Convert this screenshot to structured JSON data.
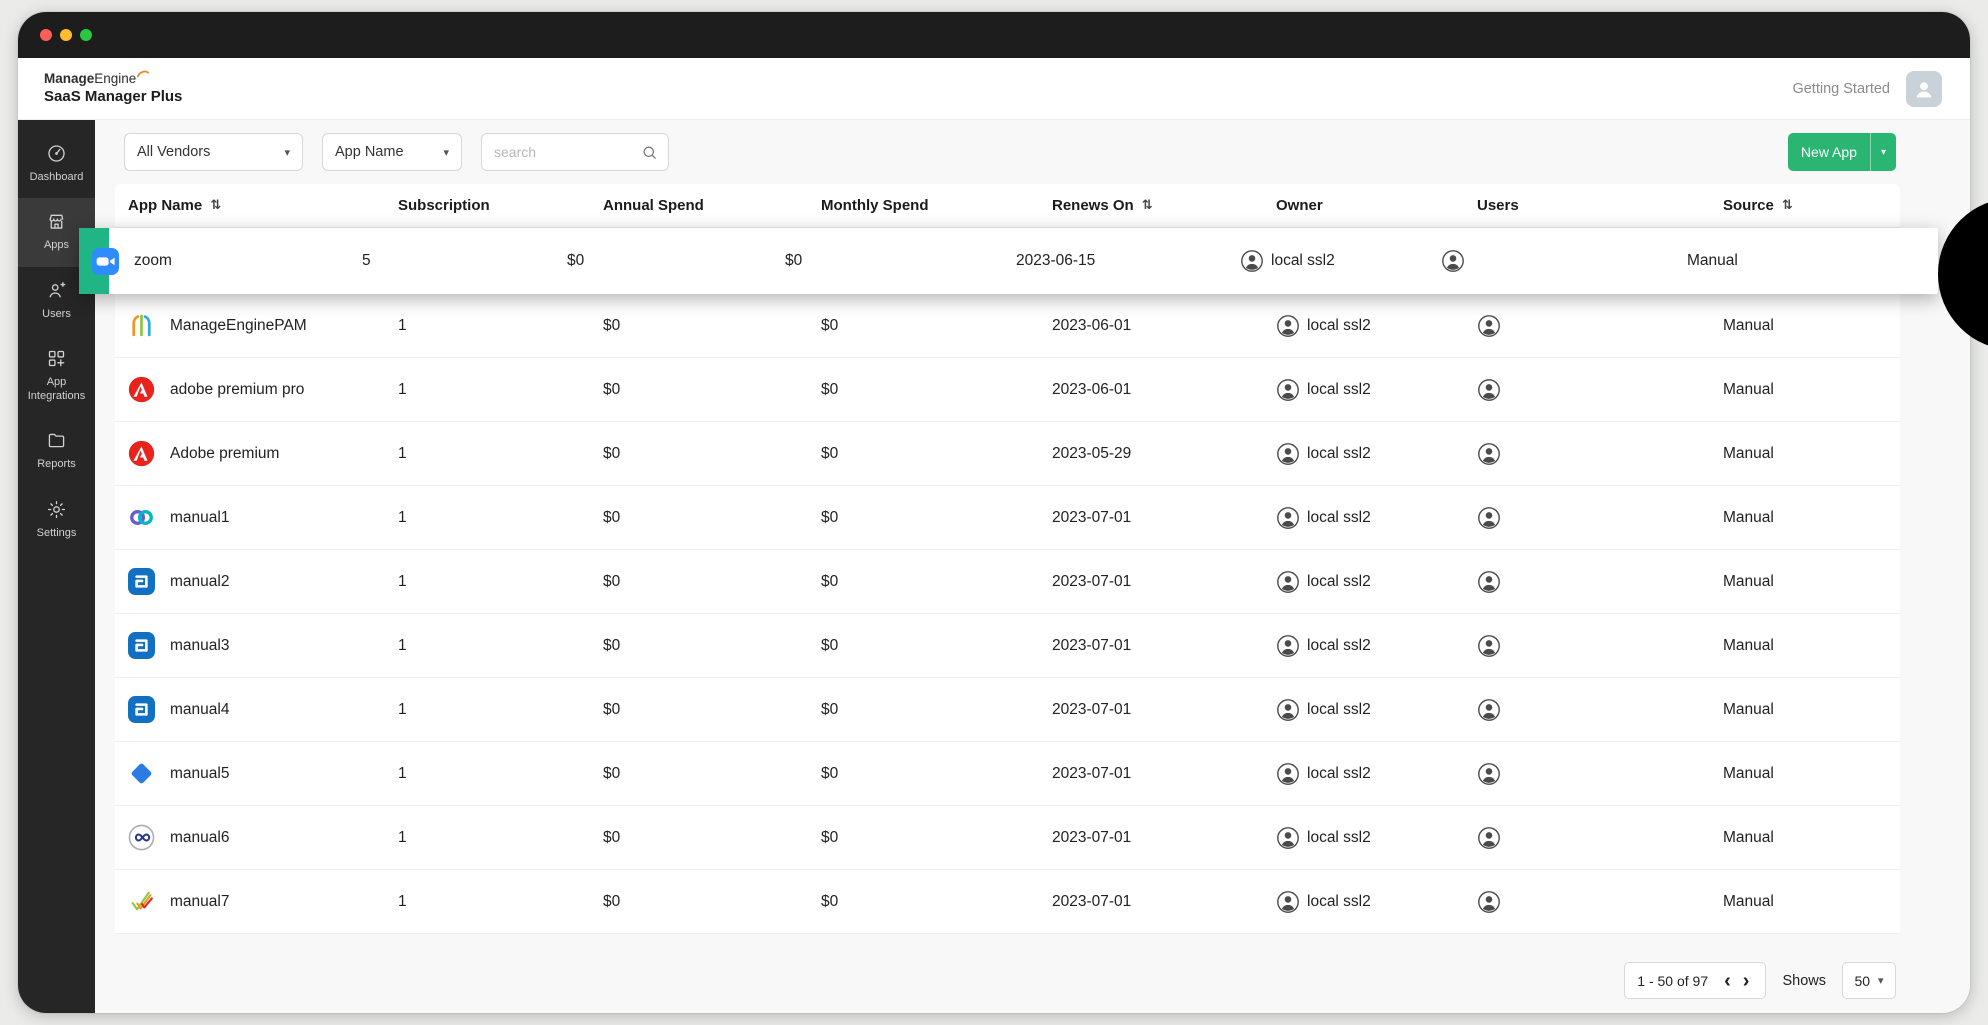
{
  "window": {
    "traffic_lights": [
      "#ff5f57",
      "#febc2e",
      "#28c840"
    ]
  },
  "header": {
    "brand_bold": "Manage",
    "brand_rest": "Engine",
    "brand_product": "SaaS Manager Plus",
    "getting_started": "Getting Started"
  },
  "sidebar": {
    "items": [
      {
        "label": "Dashboard",
        "icon": "dashboard-icon",
        "active": false
      },
      {
        "label": "Apps",
        "icon": "apps-icon",
        "active": true
      },
      {
        "label": "Users",
        "icon": "users-icon",
        "active": false
      },
      {
        "label": "App Integrations",
        "icon": "integrations-icon",
        "active": false
      },
      {
        "label": "Reports",
        "icon": "reports-icon",
        "active": false
      },
      {
        "label": "Settings",
        "icon": "settings-icon",
        "active": false
      }
    ]
  },
  "filters": {
    "vendor_select": "All Vendors",
    "field_select": "App Name",
    "search_placeholder": "search",
    "new_app_label": "New App"
  },
  "table": {
    "columns": [
      {
        "label": "App Name",
        "sortable": true
      },
      {
        "label": "Subscription",
        "sortable": false
      },
      {
        "label": "Annual Spend",
        "sortable": false
      },
      {
        "label": "Monthly Spend",
        "sortable": false
      },
      {
        "label": "Renews On",
        "sortable": true
      },
      {
        "label": "Owner",
        "sortable": false
      },
      {
        "label": "Users",
        "sortable": false
      },
      {
        "label": "Source",
        "sortable": true
      }
    ],
    "rows": [
      {
        "app": "zoom",
        "icon": "zoom-icon",
        "subscription": "5",
        "annual": "$0",
        "monthly": "$0",
        "renews": "2023-06-15",
        "owner": "local ssl2",
        "source": "Manual",
        "highlight": true
      },
      {
        "app": "ManageEnginePAM",
        "icon": "mepam-icon",
        "subscription": "1",
        "annual": "$0",
        "monthly": "$0",
        "renews": "2023-06-01",
        "owner": "local ssl2",
        "source": "Manual",
        "highlight": false
      },
      {
        "app": "adobe premium pro",
        "icon": "adobe-icon",
        "subscription": "1",
        "annual": "$0",
        "monthly": "$0",
        "renews": "2023-06-01",
        "owner": "local ssl2",
        "source": "Manual",
        "highlight": false
      },
      {
        "app": "Adobe premium",
        "icon": "adobe-icon",
        "subscription": "1",
        "annual": "$0",
        "monthly": "$0",
        "renews": "2023-05-29",
        "owner": "local ssl2",
        "source": "Manual",
        "highlight": false
      },
      {
        "app": "manual1",
        "icon": "rings-icon",
        "subscription": "1",
        "annual": "$0",
        "monthly": "$0",
        "renews": "2023-07-01",
        "owner": "local ssl2",
        "source": "Manual",
        "highlight": false
      },
      {
        "app": "manual2",
        "icon": "sd-icon",
        "subscription": "1",
        "annual": "$0",
        "monthly": "$0",
        "renews": "2023-07-01",
        "owner": "local ssl2",
        "source": "Manual",
        "highlight": false
      },
      {
        "app": "manual3",
        "icon": "sd-icon",
        "subscription": "1",
        "annual": "$0",
        "monthly": "$0",
        "renews": "2023-07-01",
        "owner": "local ssl2",
        "source": "Manual",
        "highlight": false
      },
      {
        "app": "manual4",
        "icon": "sd-icon",
        "subscription": "1",
        "annual": "$0",
        "monthly": "$0",
        "renews": "2023-07-01",
        "owner": "local ssl2",
        "source": "Manual",
        "highlight": false
      },
      {
        "app": "manual5",
        "icon": "diamond-icon",
        "subscription": "1",
        "annual": "$0",
        "monthly": "$0",
        "renews": "2023-07-01",
        "owner": "local ssl2",
        "source": "Manual",
        "highlight": false
      },
      {
        "app": "manual6",
        "icon": "infinity-icon",
        "subscription": "1",
        "annual": "$0",
        "monthly": "$0",
        "renews": "2023-07-01",
        "owner": "local ssl2",
        "source": "Manual",
        "highlight": false
      },
      {
        "app": "manual7",
        "icon": "check-icon",
        "subscription": "1",
        "annual": "$0",
        "monthly": "$0",
        "renews": "2023-07-01",
        "owner": "local ssl2",
        "source": "Manual",
        "highlight": false
      }
    ]
  },
  "pagination": {
    "range": "1 - 50 of 97",
    "shows_label": "Shows",
    "page_size": "50"
  },
  "colors": {
    "accent_green": "#2bb573",
    "highlight_accent": "#1fb585"
  }
}
